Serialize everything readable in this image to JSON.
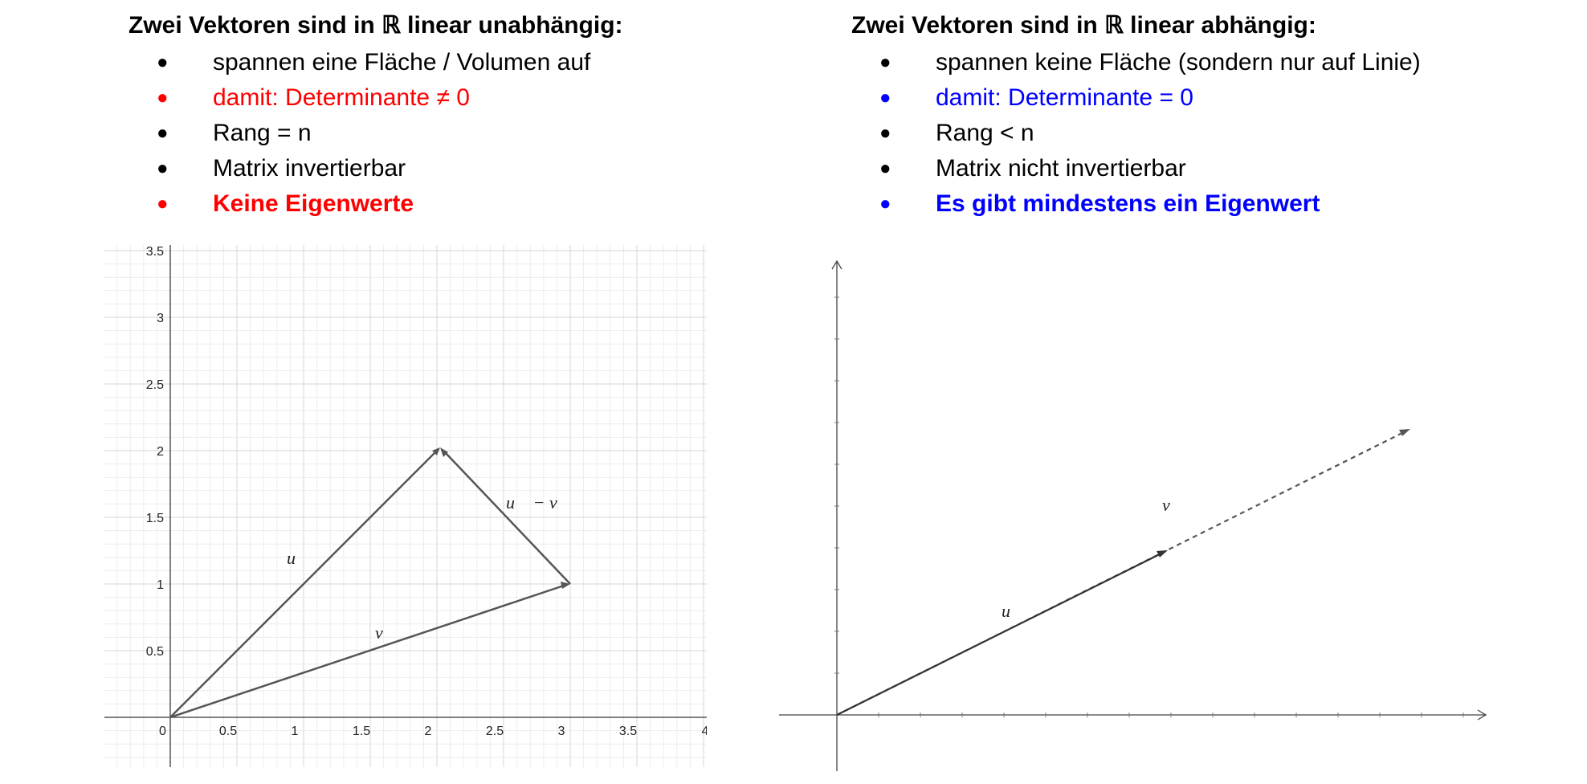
{
  "left": {
    "heading": "Zwei Vektoren sind in ℝ linear unabhängig:",
    "bullets": [
      {
        "text": "spannen eine Fläche / Volumen auf",
        "color": "#000000",
        "bold": false
      },
      {
        "text": "damit: Determinante ≠ 0",
        "color": "#ff0000",
        "bold": false
      },
      {
        "text": "Rang = n",
        "color": "#000000",
        "bold": false
      },
      {
        "text": "Matrix invertierbar",
        "color": "#000000",
        "bold": false
      },
      {
        "text": "Keine Eigenwerte",
        "color": "#ff0000",
        "bold": true
      }
    ]
  },
  "right": {
    "heading": "Zwei Vektoren sind in ℝ linear abhängig:",
    "bullets": [
      {
        "text": "spannen keine Fläche (sondern nur auf Linie)",
        "color": "#000000",
        "bold": false
      },
      {
        "text": "damit: Determinante = 0",
        "color": "#0000ff",
        "bold": false
      },
      {
        "text": "Rang < n",
        "color": "#000000",
        "bold": false
      },
      {
        "text": "Matrix nicht invertierbar",
        "color": "#000000",
        "bold": false
      },
      {
        "text": "Es gibt mindestens ein Eigenwert",
        "color": "#0000ff",
        "bold": true
      }
    ]
  },
  "plot_left": {
    "x_ticks": [
      "0.5",
      "1",
      "1.5",
      "2",
      "2.5",
      "3",
      "3.5",
      "4"
    ],
    "y_ticks": [
      "0.5",
      "1",
      "1.5",
      "2",
      "2.5",
      "3",
      "3.5"
    ],
    "origin_label": "0",
    "vectors": [
      {
        "name": "u",
        "label": "u⃗",
        "from": [
          0,
          0
        ],
        "to": [
          2,
          2
        ]
      },
      {
        "name": "v",
        "label": "v⃗",
        "from": [
          0,
          0
        ],
        "to": [
          3,
          1
        ]
      },
      {
        "name": "u-v",
        "label": "u⃗ − v⃗",
        "from": [
          3,
          1
        ],
        "to": [
          2,
          2
        ]
      }
    ]
  },
  "plot_right": {
    "vectors": [
      {
        "name": "u",
        "label": "u⃗",
        "style": "solid"
      },
      {
        "name": "v",
        "label": "v⃗",
        "style": "dashed"
      }
    ]
  },
  "colors": {
    "accent_red": "#ff0000",
    "accent_blue": "#0000ff",
    "vector": "#555555",
    "grid": "#e2e2e2"
  }
}
